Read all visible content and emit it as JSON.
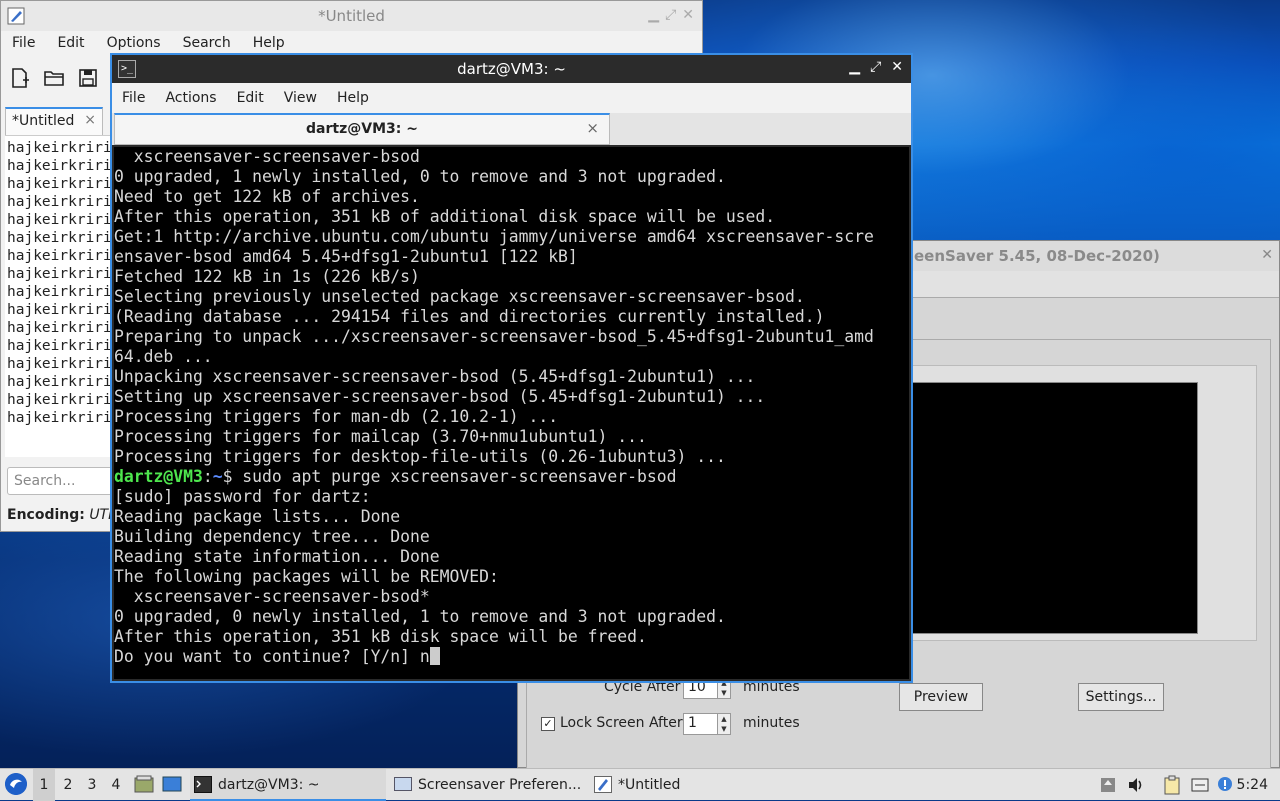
{
  "mousepad": {
    "title": "*Untitled",
    "menu": [
      "File",
      "Edit",
      "Options",
      "Search",
      "Help"
    ],
    "tab_label": "*Untitled",
    "tab_close": "×",
    "lines": [
      "hajkeirkriri",
      "hajkeirkriri",
      "hajkeirkriri",
      "hajkeirkriri",
      "hajkeirkriri",
      "hajkeirkriri",
      "hajkeirkriri",
      "hajkeirkriri",
      "hajkeirkriri",
      "hajkeirkriri",
      "hajkeirkriri",
      "hajkeirkriri",
      "hajkeirkriri",
      "hajkeirkriri",
      "hajkeirkriri",
      "hajkeirkriri"
    ],
    "search_placeholder": "Search...",
    "encoding_label": "Encoding:",
    "encoding_value": "UTF-"
  },
  "screensaver": {
    "title": "eenSaver 5.45, 08-Dec-2020)",
    "cycle_label": "Cycle After",
    "cycle_value": "10",
    "cycle_unit": "minutes",
    "lock_label": "Lock Screen After",
    "lock_value": "1",
    "lock_unit": "minutes",
    "lock_checked": "✓",
    "preview_button": "Preview",
    "settings_button": "Settings..."
  },
  "terminal": {
    "title": "dartz@VM3: ~",
    "tab_label": "dartz@VM3: ~",
    "tab_close": "×",
    "menu": [
      "File",
      "Actions",
      "Edit",
      "View",
      "Help"
    ],
    "lines": [
      "  xscreensaver-screensaver-bsod",
      "0 upgraded, 1 newly installed, 0 to remove and 3 not upgraded.",
      "Need to get 122 kB of archives.",
      "After this operation, 351 kB of additional disk space will be used.",
      "Get:1 http://archive.ubuntu.com/ubuntu jammy/universe amd64 xscreensaver-scre",
      "ensaver-bsod amd64 5.45+dfsg1-2ubuntu1 [122 kB]",
      "Fetched 122 kB in 1s (226 kB/s)",
      "Selecting previously unselected package xscreensaver-screensaver-bsod.",
      "(Reading database ... 294154 files and directories currently installed.)",
      "Preparing to unpack .../xscreensaver-screensaver-bsod_5.45+dfsg1-2ubuntu1_amd",
      "64.deb ...",
      "Unpacking xscreensaver-screensaver-bsod (5.45+dfsg1-2ubuntu1) ...",
      "Setting up xscreensaver-screensaver-bsod (5.45+dfsg1-2ubuntu1) ...",
      "Processing triggers for man-db (2.10.2-1) ...",
      "Processing triggers for mailcap (3.70+nmu1ubuntu1) ...",
      "Processing triggers for desktop-file-utils (0.26-1ubuntu3) ..."
    ],
    "prompt_user": "dartz@VM3",
    "prompt_sep": ":",
    "prompt_path": "~",
    "prompt_cmd": "$ sudo apt purge xscreensaver-screensaver-bsod",
    "lines_after": [
      "[sudo] password for dartz:",
      "Reading package lists... Done",
      "Building dependency tree... Done",
      "Reading state information... Done",
      "The following packages will be REMOVED:",
      "  xscreensaver-screensaver-bsod*",
      "0 upgraded, 0 newly installed, 1 to remove and 3 not upgraded.",
      "After this operation, 351 kB disk space will be freed."
    ],
    "last_line": "Do you want to continue? [Y/n] n"
  },
  "taskbar": {
    "workspaces": [
      "1",
      "2",
      "3",
      "4"
    ],
    "tasks": [
      "dartz@VM3: ~",
      "Screensaver Preferen...",
      "*Untitled"
    ],
    "clock": "5:24"
  },
  "colors": {
    "accent": "#3a8ee6",
    "prompt_user": "#4ee64e",
    "prompt_path": "#5c8cff"
  }
}
